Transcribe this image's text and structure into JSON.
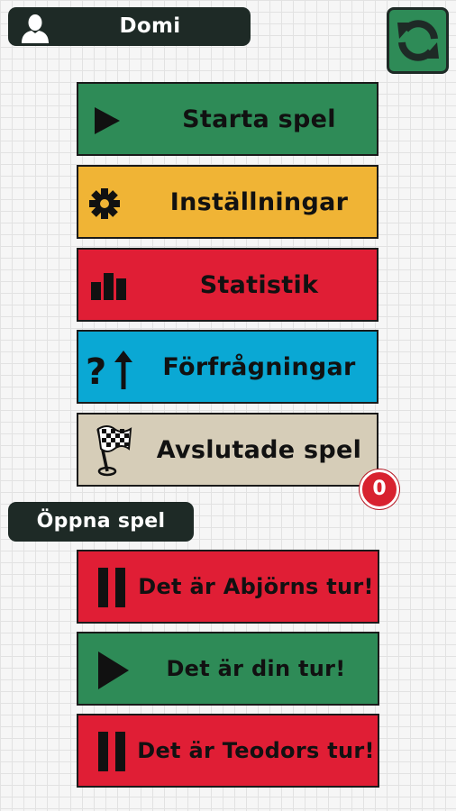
{
  "user": {
    "name": "Domi",
    "avatar_icon": "person-silhouette-icon"
  },
  "refresh": {
    "icon": "refresh-arrows-icon"
  },
  "menu": [
    {
      "label": "Starta spel",
      "icon": "play-icon",
      "color": "#2e8b57"
    },
    {
      "label": "Inställningar",
      "icon": "gear-icon",
      "color": "#f0b435"
    },
    {
      "label": "Statistik",
      "icon": "bar-chart-icon",
      "color": "#e01e35"
    },
    {
      "label": "Förfrågningar",
      "icon": "question-arrow-icon",
      "color": "#0aa8d4"
    },
    {
      "label": "Avslutade spel",
      "icon": "checkered-flag-icon",
      "color": "#d6cdb8",
      "badge": "0"
    }
  ],
  "open_games": {
    "header": "Öppna spel",
    "games": [
      {
        "label": "Det är Abjörns tur!",
        "status": "waiting",
        "icon": "pause-icon",
        "color": "#e01e35"
      },
      {
        "label": "Det är din tur!",
        "status": "your-turn",
        "icon": "play-icon",
        "color": "#2e8b57"
      },
      {
        "label": "Det är Teodors tur!",
        "status": "waiting",
        "icon": "pause-icon",
        "color": "#e01e35"
      }
    ]
  }
}
